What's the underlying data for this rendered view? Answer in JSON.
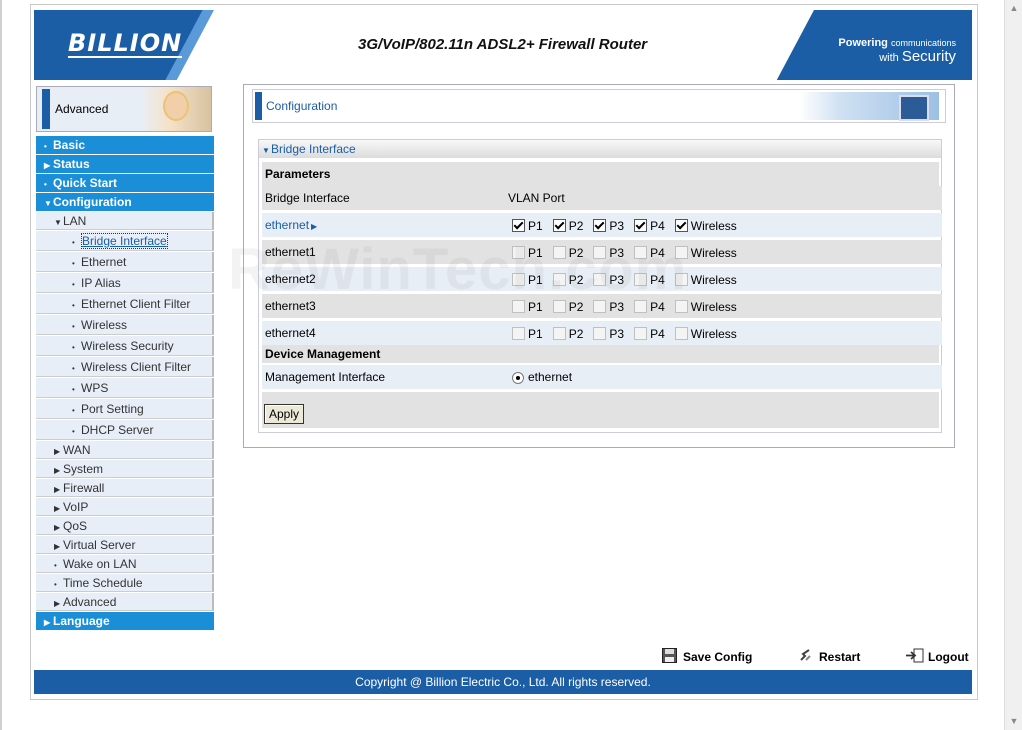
{
  "header": {
    "logo": "BILLION",
    "product_title": "3G/VoIP/802.11n ADSL2+ Firewall Router",
    "slogan_line1": "Powering",
    "slogan_line1b": "communications",
    "slogan_line2a": "with",
    "slogan_line2b": "Security"
  },
  "sidebar": {
    "mode_label": "Advanced",
    "items": [
      {
        "label": "Basic",
        "level": "top",
        "marker": "dot"
      },
      {
        "label": "Status",
        "level": "top",
        "marker": "arrow"
      },
      {
        "label": "Quick Start",
        "level": "top",
        "marker": "dot"
      },
      {
        "label": "Configuration",
        "level": "top",
        "marker": "down"
      },
      {
        "label": "LAN",
        "level": "sub",
        "marker": "down"
      },
      {
        "label": "Bridge Interface",
        "level": "sub2",
        "marker": "dot",
        "active": true
      },
      {
        "label": "Ethernet",
        "level": "sub2",
        "marker": "dot"
      },
      {
        "label": "IP Alias",
        "level": "sub2",
        "marker": "dot"
      },
      {
        "label": "Ethernet Client Filter",
        "level": "sub2",
        "marker": "dot"
      },
      {
        "label": "Wireless",
        "level": "sub2",
        "marker": "dot"
      },
      {
        "label": "Wireless Security",
        "level": "sub2",
        "marker": "dot"
      },
      {
        "label": "Wireless Client Filter",
        "level": "sub2",
        "marker": "dot"
      },
      {
        "label": "WPS",
        "level": "sub2",
        "marker": "dot"
      },
      {
        "label": "Port Setting",
        "level": "sub2",
        "marker": "dot"
      },
      {
        "label": "DHCP Server",
        "level": "sub2",
        "marker": "dot"
      },
      {
        "label": "WAN",
        "level": "sub",
        "marker": "arrow"
      },
      {
        "label": "System",
        "level": "sub",
        "marker": "arrow"
      },
      {
        "label": "Firewall",
        "level": "sub",
        "marker": "arrow"
      },
      {
        "label": "VoIP",
        "level": "sub",
        "marker": "arrow"
      },
      {
        "label": "QoS",
        "level": "sub",
        "marker": "arrow"
      },
      {
        "label": "Virtual Server",
        "level": "sub",
        "marker": "arrow"
      },
      {
        "label": "Wake on LAN",
        "level": "sub",
        "marker": "dot"
      },
      {
        "label": "Time Schedule",
        "level": "sub",
        "marker": "dot"
      },
      {
        "label": "Advanced",
        "level": "sub",
        "marker": "arrow"
      },
      {
        "label": "Language",
        "level": "top",
        "marker": "arrow"
      }
    ]
  },
  "main": {
    "page_title": "Configuration",
    "section_title": "Bridge Interface",
    "parameters_label": "Parameters",
    "col1_header": "Bridge Interface",
    "col2_header": "VLAN Port",
    "port_labels": [
      "P1",
      "P2",
      "P3",
      "P4",
      "Wireless"
    ],
    "interfaces": [
      {
        "name": "ethernet",
        "is_link": true,
        "checked": [
          true,
          true,
          true,
          true,
          true
        ],
        "enabled": true
      },
      {
        "name": "ethernet1",
        "is_link": false,
        "checked": [
          false,
          false,
          false,
          false,
          false
        ],
        "enabled": false
      },
      {
        "name": "ethernet2",
        "is_link": false,
        "checked": [
          false,
          false,
          false,
          false,
          false
        ],
        "enabled": false
      },
      {
        "name": "ethernet3",
        "is_link": false,
        "checked": [
          false,
          false,
          false,
          false,
          false
        ],
        "enabled": false
      },
      {
        "name": "ethernet4",
        "is_link": false,
        "checked": [
          false,
          false,
          false,
          false,
          false
        ],
        "enabled": false
      }
    ],
    "device_management_label": "Device Management",
    "management_interface_label": "Management Interface",
    "management_interface_value": "ethernet",
    "apply_label": "Apply"
  },
  "footer": {
    "save_config": "Save Config",
    "restart": "Restart",
    "logout": "Logout",
    "copyright": "Copyright @ Billion Electric Co., Ltd. All rights reserved."
  },
  "watermark": "ReWinTech.com"
}
